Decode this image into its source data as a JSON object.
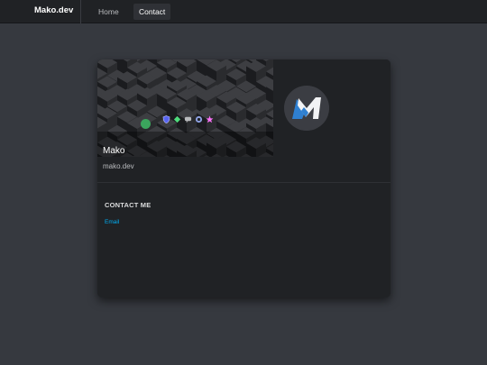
{
  "navbar": {
    "brand": "Mako.dev",
    "links": [
      {
        "label": "Home"
      },
      {
        "label": "Contact"
      }
    ]
  },
  "profile": {
    "display_name": "Mako",
    "subtitle": "mako.dev",
    "status_color": "#3ba55d",
    "avatar_icon": "mako-logo-icon",
    "badges": [
      {
        "icon": "shield-badge-icon",
        "color": "#5865f2"
      },
      {
        "icon": "gem-badge-icon",
        "color": "#4fdc7c"
      },
      {
        "icon": "chat-badge-icon",
        "color": "#b9bbbe"
      },
      {
        "icon": "nitro-badge-icon",
        "color": "#8ea1e1"
      },
      {
        "icon": "star-badge-icon",
        "color": "#ff73fa"
      }
    ]
  },
  "contact": {
    "title": "CONTACT ME",
    "links": [
      {
        "label": "Email"
      }
    ]
  },
  "colors": {
    "page_bg": "#36393f",
    "nav_bg": "#202225",
    "card_bg": "#202225",
    "link": "#00aff4",
    "accent_blue": "#2f80d1"
  }
}
